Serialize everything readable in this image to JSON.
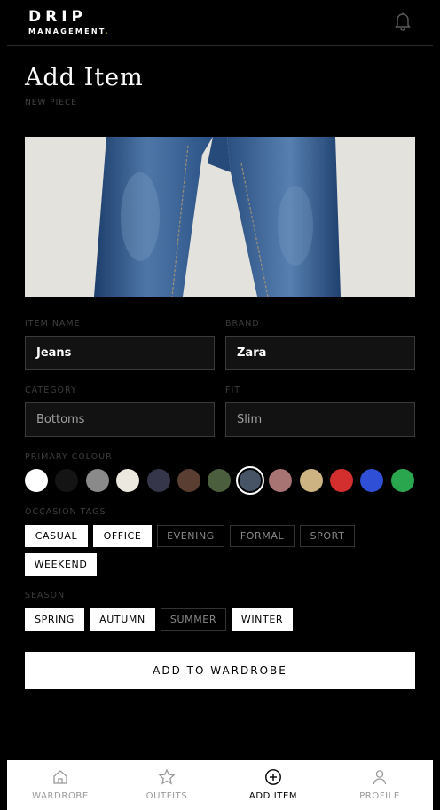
{
  "brand": {
    "name": "DRIP",
    "sub": "MANAGEMENT",
    "accent": "#d4b046"
  },
  "page": {
    "title": "Add Item",
    "subtitle": "NEW PIECE"
  },
  "form": {
    "item_name": {
      "label": "ITEM NAME",
      "value": "Jeans"
    },
    "brand": {
      "label": "BRAND",
      "value": "Zara"
    },
    "category": {
      "label": "CATEGORY",
      "placeholder": "Bottoms"
    },
    "fit": {
      "label": "FIT",
      "placeholder": "Slim"
    },
    "primary_colour": {
      "label": "PRIMARY COLOUR",
      "options": [
        "#ffffff",
        "#141414",
        "#8a8a8a",
        "#ece7df",
        "#35364a",
        "#5a3e31",
        "#4b5e3e",
        "#475466",
        "#a87373",
        "#cdb282",
        "#d32f2f",
        "#2e4fd6",
        "#2aa64f"
      ],
      "selected": "#475466"
    },
    "occasion": {
      "label": "OCCASION TAGS",
      "tags": [
        {
          "label": "CASUAL",
          "selected": true
        },
        {
          "label": "OFFICE",
          "selected": true
        },
        {
          "label": "EVENING",
          "selected": false
        },
        {
          "label": "FORMAL",
          "selected": false
        },
        {
          "label": "SPORT",
          "selected": false
        },
        {
          "label": "WEEKEND",
          "selected": true
        }
      ]
    },
    "season": {
      "label": "SEASON",
      "tags": [
        {
          "label": "SPRING",
          "selected": true
        },
        {
          "label": "AUTUMN",
          "selected": true
        },
        {
          "label": "SUMMER",
          "selected": false
        },
        {
          "label": "WINTER",
          "selected": true
        }
      ]
    },
    "submit_label": "ADD TO WARDROBE"
  },
  "nav": {
    "items": [
      {
        "label": "WARDROBE",
        "icon": "home-icon",
        "active": false
      },
      {
        "label": "OUTFITS",
        "icon": "star-icon",
        "active": false
      },
      {
        "label": "ADD ITEM",
        "icon": "plus-circle-icon",
        "active": true
      },
      {
        "label": "PROFILE",
        "icon": "user-icon",
        "active": false
      }
    ]
  }
}
